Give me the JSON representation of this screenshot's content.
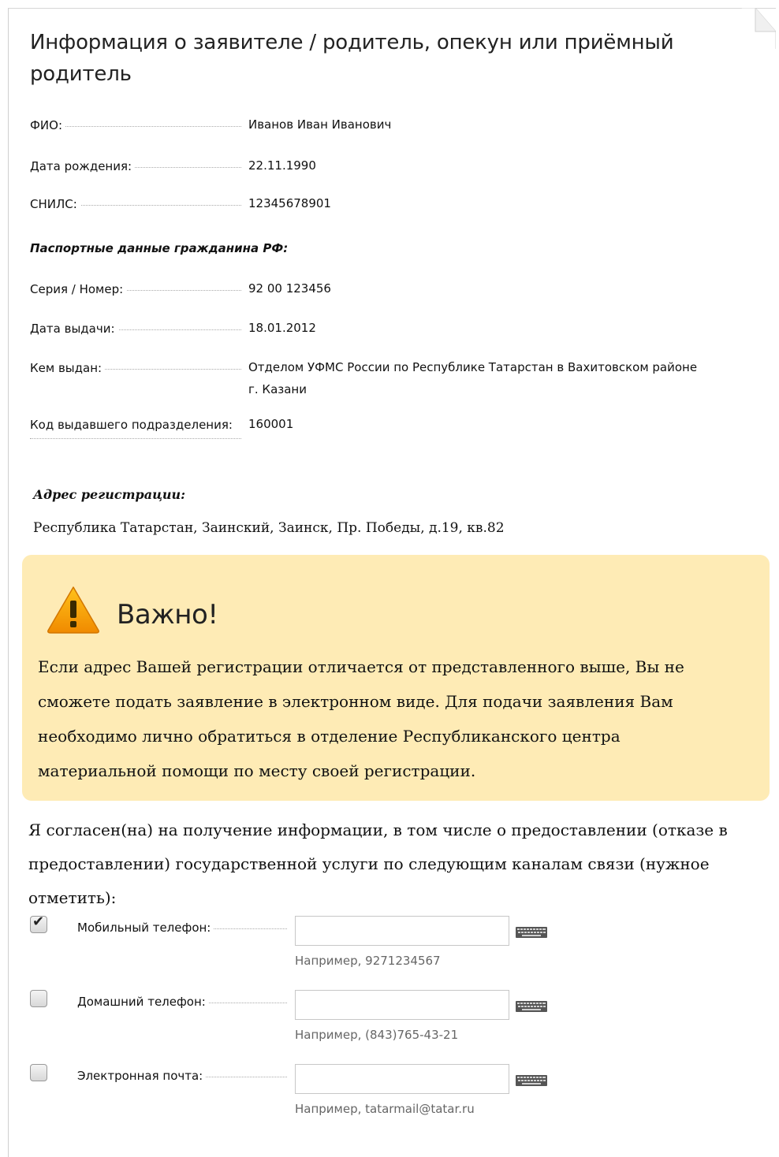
{
  "title": "Информация о заявителе / родитель, опекун или приёмный родитель",
  "fields": {
    "fio": {
      "label": "ФИО:",
      "value": "Иванов Иван Иванович"
    },
    "birth": {
      "label": "Дата рождения:",
      "value": "22.11.1990"
    },
    "snils": {
      "label": "СНИЛС:",
      "value": "12345678901"
    }
  },
  "passport": {
    "heading": "Паспортные данные гражданина РФ:",
    "series": {
      "label": "Серия / Номер:",
      "value": "92 00 123456"
    },
    "issue_date": {
      "label": "Дата выдачи:",
      "value": "18.01.2012"
    },
    "issued_by": {
      "label": "Кем выдан:",
      "value": "Отделом УФМС России по Республике Татарстан в Вахитовском районе г. Казани"
    },
    "dept_code": {
      "label": "Код выдавшего подразделения:",
      "value": "160001"
    }
  },
  "address": {
    "heading": "Адрес регистрации:",
    "value": "Республика Татарстан, Заинский, Заинск, Пр. Победы, д.19, кв.82"
  },
  "warning": {
    "title": "Важно!",
    "text": "Если адрес Вашей регистрации отличается от представленного выше, Вы не сможете подать заявление в электронном виде. Для подачи заявления Вам необходимо лично обратиться в отделение Республиканского центра материальной помощи по месту своей регистрации.",
    "icon": "warning-triangle-icon",
    "bg_color": "#feebb5",
    "icon_color": "#f5a000"
  },
  "consent": {
    "text": "Я согласен(на) на получение информации, в том числе о предоставлении (отказе в предоставлении) государственной услуги по следующим каналам связи (нужное отметить):"
  },
  "contacts": [
    {
      "label": "Мобильный телефон:",
      "checked": true,
      "value": "",
      "hint": "Например, 9271234567"
    },
    {
      "label": "Домашний телефон:",
      "checked": false,
      "value": "",
      "hint": "Например, (843)765-43-21"
    },
    {
      "label": "Электронная почта:",
      "checked": false,
      "value": "",
      "hint": "Например, tatarmail@tatar.ru"
    }
  ],
  "keyboard_icon": "keyboard-icon"
}
